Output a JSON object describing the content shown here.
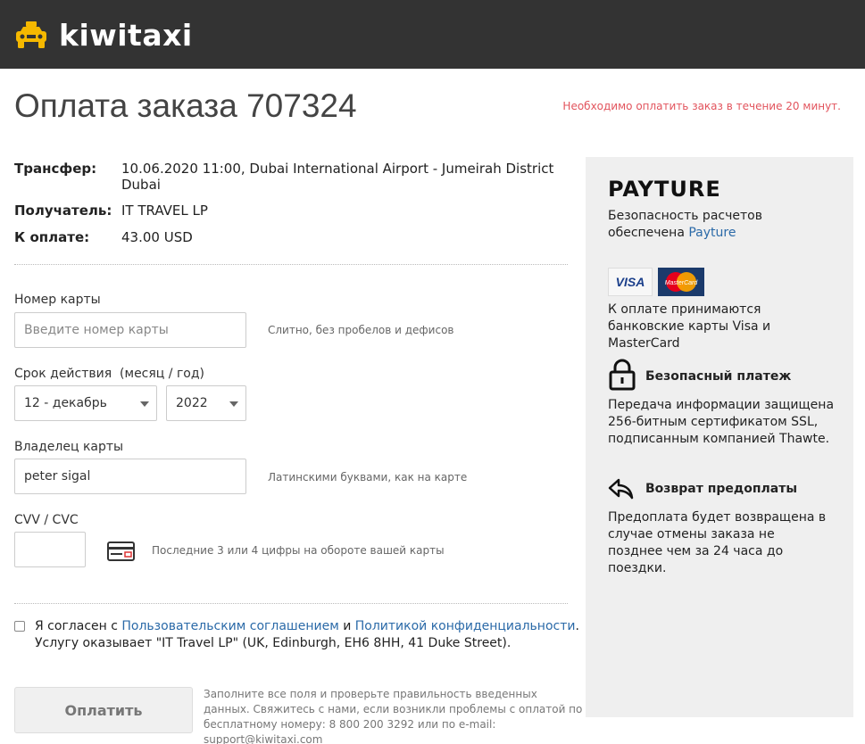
{
  "header": {
    "logo_text": "kiwitaxi"
  },
  "page": {
    "title": "Оплата заказа 707324",
    "time_warning": "Необходимо оплатить заказ в течение 20 минут."
  },
  "summary": {
    "transfer_label": "Трансфер:",
    "transfer_value": "10.06.2020 11:00, Dubai International Airport - Jumeirah District Dubai",
    "recipient_label": "Получатель:",
    "recipient_value": "IT TRAVEL LP",
    "amount_label": "К оплате:",
    "amount_value": "43.00 USD"
  },
  "form": {
    "card_number_label": "Номер карты",
    "card_number_placeholder": "Введите номер карты",
    "card_number_value": "",
    "card_number_hint": "Слитно, без пробелов и дефисов",
    "expiry_label": "Срок действия  (месяц / год)",
    "expiry_month": "12 - декабрь",
    "expiry_year": "2022",
    "holder_label": "Владелец карты",
    "holder_value": "peter sigal",
    "holder_hint": "Латинскими буквами, как на карте",
    "cvv_label": "CVV / CVC",
    "cvv_value": "",
    "cvv_hint": "Последние 3 или 4 цифры на обороте вашей карты"
  },
  "agreement": {
    "checked": false,
    "text_1": "Я согласен с ",
    "link_terms": "Пользовательским соглашением",
    "text_2": " и ",
    "link_privacy": "Политикой конфиденциальности",
    "text_3": ". Услугу оказывает \"IT Travel LP\" (UK, Edinburgh, EH6 8HH, 41 Duke Street)."
  },
  "submit": {
    "label": "Оплатить",
    "note": "Заполните все поля и проверьте правильность введенных данных. Свяжитесь с нами, если возникли проблемы с оплатой по бесплатному номеру: 8 800 200 3292 или по e-mail: support@kiwitaxi.com"
  },
  "sidebar": {
    "payture_logo": "PAYTURE",
    "security_text": "Безопасность расчетов обеспечена ",
    "security_link": "Payture",
    "visa_label": "VISA",
    "mc_label": "MasterCard",
    "cards_text": "К оплате принимаются банковские карты Visa и MasterCard",
    "secure_title": "Безопасный платеж",
    "secure_text": "Передача информации защищена 256-битным сертификатом SSL, подписанным компанией Thawte.",
    "refund_title": "Возврат предоплаты",
    "refund_text": "Предоплата будет возвращена в случае отмены заказа не позднее чем за 24 часа до поездки."
  },
  "colors": {
    "header_bg": "#333333",
    "taxi_yellow": "#f5b800",
    "warning": "#e2545d",
    "link": "#2b6aa8"
  }
}
